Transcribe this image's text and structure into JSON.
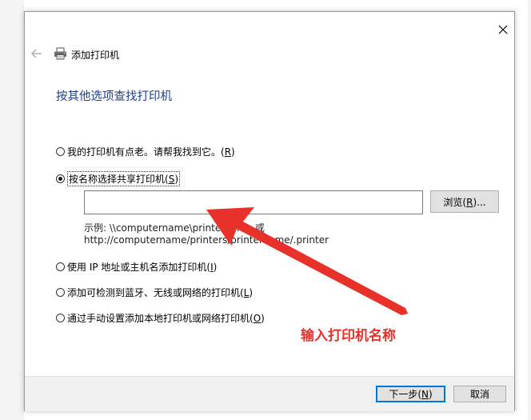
{
  "window": {
    "title": "添加打印机",
    "heading": "按其他选项查找打印机"
  },
  "options": [
    {
      "text": "我的打印机有点老。请帮我找到它。",
      "access_key": "R",
      "checked": false
    },
    {
      "text": "按名称选择共享打印机",
      "access_key": "S",
      "checked": true
    },
    {
      "text": "使用 IP 地址或主机名添加打印机",
      "access_key": "I",
      "checked": false
    },
    {
      "text": "添加可检测到蓝牙、无线或网络的打印机",
      "access_key": "L",
      "checked": false
    },
    {
      "text": "通过手动设置添加本地打印机或网络打印机",
      "access_key": "O",
      "checked": false
    }
  ],
  "shared_printer": {
    "input_value": "",
    "browse_label": "浏览",
    "browse_key": "R",
    "browse_suffix": "...",
    "example_line1": "示例: \\\\computername\\printername 或",
    "example_line2": "http://computername/printers/printername/.printer"
  },
  "footer": {
    "next_label": "下一步",
    "next_key": "N",
    "cancel_label": "取消"
  },
  "annotation": {
    "text": "输入打印机名称",
    "color": "#e8312a"
  },
  "colors": {
    "heading": "#1e3f8a",
    "primary_button_border": "#0078d7"
  }
}
